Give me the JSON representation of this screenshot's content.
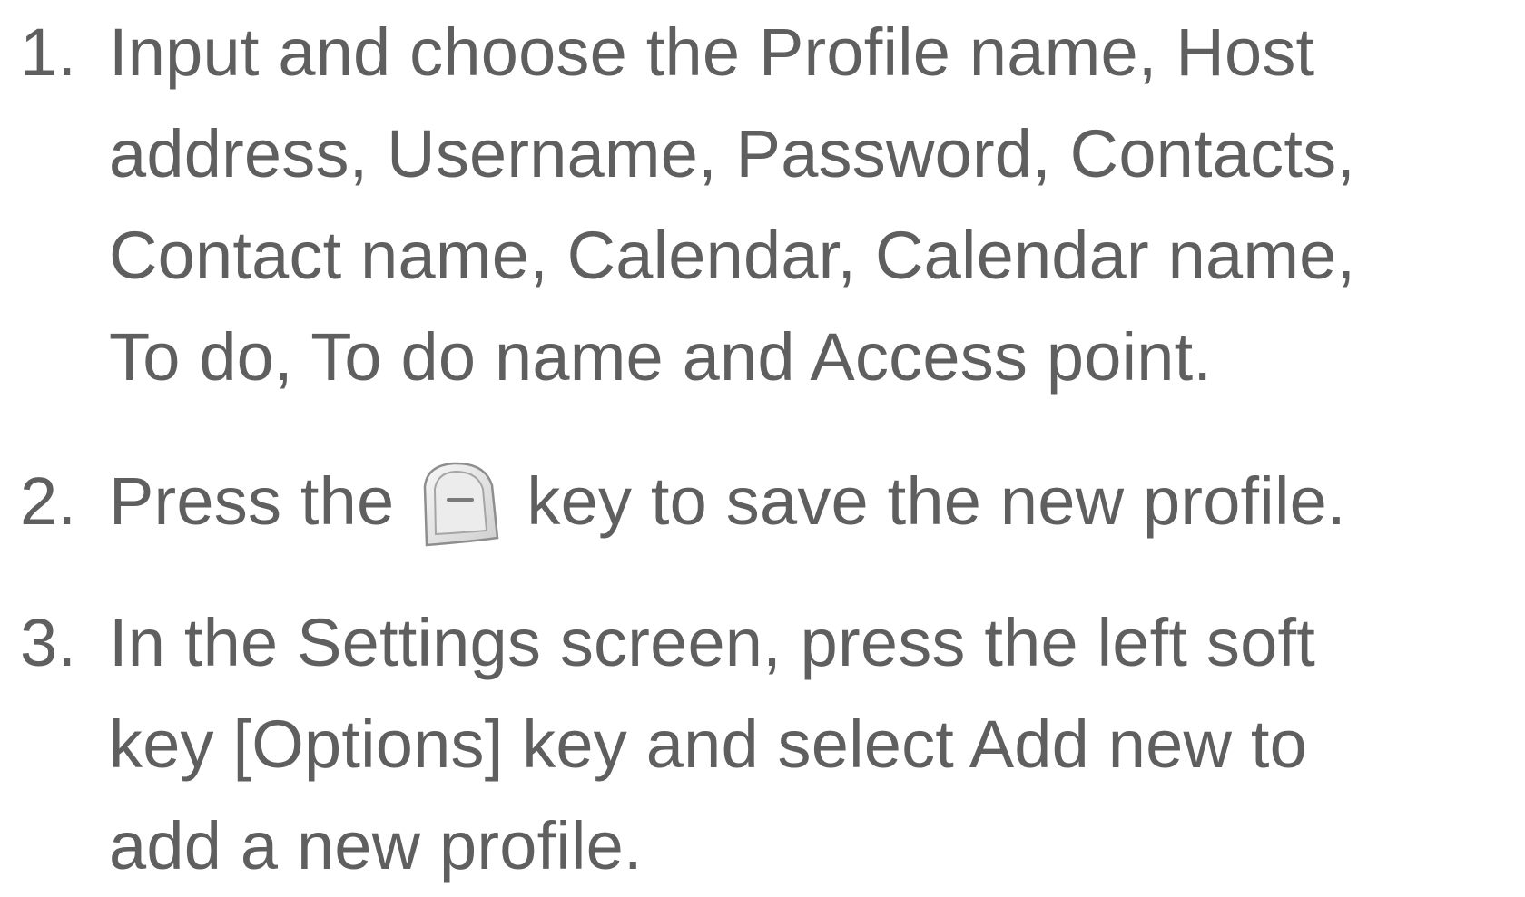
{
  "steps": [
    {
      "number": "1.",
      "lines": [
        "Input and choose the Profile name, Host",
        "address, Username, Password, Contacts,",
        "Contact name, Calendar, Calendar name,",
        "To do, To do name and Access point."
      ]
    },
    {
      "number": "2.",
      "before_icon": "Press the",
      "icon": "soft-key-icon",
      "after_icon": "key to save the new profile."
    },
    {
      "number": "3.",
      "lines": [
        "In the Settings screen, press the left soft",
        "key [Options] key and select Add new to",
        "add a new profile."
      ]
    }
  ]
}
